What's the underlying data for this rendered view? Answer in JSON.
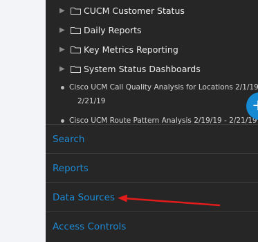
{
  "tree": {
    "folders": [
      {
        "label": "CUCM Customer Status"
      },
      {
        "label": "Daily Reports"
      },
      {
        "label": "Key Metrics Reporting"
      },
      {
        "label": "System Status Dashboards"
      }
    ],
    "reports": [
      {
        "label": "Cisco UCM Call Quality Analysis for Locations 2/1/19 -",
        "continuation": "2/21/19"
      },
      {
        "label": "Cisco UCM Route Pattern Analysis 2/19/19 - 2/21/19"
      }
    ]
  },
  "fab": {
    "symbol": "+"
  },
  "nav": {
    "items": [
      {
        "label": "Search"
      },
      {
        "label": "Reports"
      },
      {
        "label": "Data Sources"
      },
      {
        "label": "Access Controls"
      }
    ]
  },
  "colors": {
    "panel_bg": "#262626",
    "link_blue": "#1d8ad4",
    "annotation_red": "#e21b1b",
    "fab_blue": "#1589d2"
  },
  "icons": [
    "triangle-right-icon",
    "folder-icon",
    "bullet-icon"
  ]
}
